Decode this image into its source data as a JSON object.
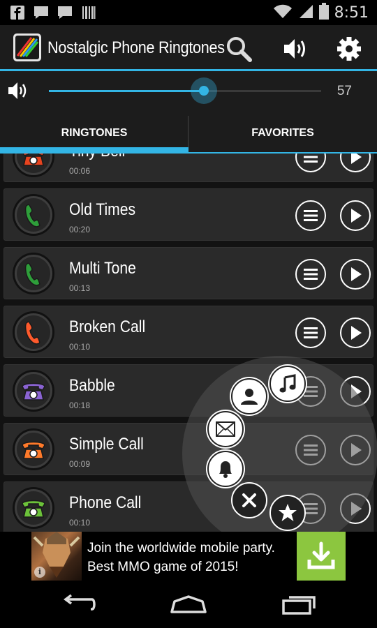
{
  "status_bar": {
    "time": "8:51",
    "left_icons": [
      "facebook-icon",
      "chat-icon",
      "chat-icon",
      "barcode-icon"
    ],
    "right_icons": [
      "wifi-icon",
      "signal-icon",
      "battery-icon"
    ]
  },
  "action_bar": {
    "title": "Nostalgic Phone Ringtones",
    "actions": [
      "search-icon",
      "speaker-icon",
      "gear-icon"
    ],
    "accent": "#33b5e5"
  },
  "volume": {
    "value": "57",
    "fraction": 0.57
  },
  "tabs": [
    {
      "label": "RINGTONES",
      "selected": true
    },
    {
      "label": "FAVORITES",
      "selected": false
    }
  ],
  "ringtones": [
    {
      "name": "Tiny Bell",
      "duration": "00:06",
      "icon": "rotary-phone",
      "color": "#e8441f"
    },
    {
      "name": "Old Times",
      "duration": "00:20",
      "icon": "handset",
      "color": "#2e9e3a"
    },
    {
      "name": "Multi Tone",
      "duration": "00:13",
      "icon": "handset",
      "color": "#2e9e3a"
    },
    {
      "name": "Broken Call",
      "duration": "00:10",
      "icon": "handset",
      "color": "#ff5a2c"
    },
    {
      "name": "Babble",
      "duration": "00:18",
      "icon": "rotary-phone",
      "color": "#8a63d2"
    },
    {
      "name": "Simple Call",
      "duration": "00:09",
      "icon": "rotary-phone",
      "color": "#ff7a2a"
    },
    {
      "name": "Phone Call",
      "duration": "00:10",
      "icon": "rotary-phone",
      "color": "#6cc23a"
    }
  ],
  "radial_menu": {
    "items": [
      "music-note-icon",
      "contact-icon",
      "envelope-icon",
      "bell-icon",
      "close-icon",
      "star-icon"
    ]
  },
  "ad": {
    "line1": "Join the worldwide mobile party.",
    "line2": "Best MMO game of 2015!",
    "info": "i",
    "download_color": "#8cc63f"
  },
  "nav_bar": [
    "back-icon",
    "home-icon",
    "recents-icon"
  ]
}
